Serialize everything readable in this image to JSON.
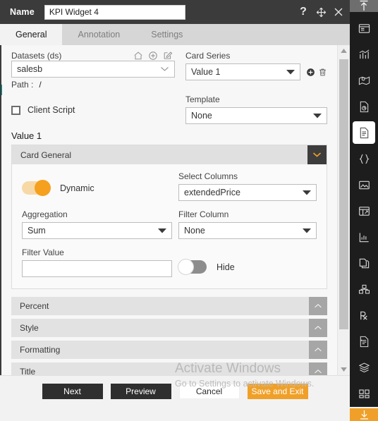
{
  "titlebar": {
    "name_label": "Name",
    "widget_name": "KPI Widget 4",
    "widget_name_placeholder": "Name",
    "help_icon": "?",
    "move_icon": "move-icon",
    "close_icon": "close-icon"
  },
  "tabs": [
    {
      "label": "General",
      "active": true
    },
    {
      "label": "Annotation",
      "active": false
    },
    {
      "label": "Settings",
      "active": false
    }
  ],
  "datasets": {
    "label": "Datasets (ds)",
    "value": "salesb",
    "icons": [
      "home-icon",
      "add-circle-icon",
      "edit-icon"
    ],
    "path_label": "Path :",
    "path_value": "/"
  },
  "client_script": {
    "label": "Client Script",
    "checked": false
  },
  "card_series": {
    "label": "Card Series",
    "value": "Value 1",
    "add_icon": "add-circle-filled-icon",
    "delete_icon": "trash-icon"
  },
  "template": {
    "label": "Template",
    "value": "None"
  },
  "value_section": {
    "title": "Value 1",
    "card_general": {
      "header": "Card General",
      "collapse_icon": "chevron-down-icon",
      "dynamic": {
        "label": "Dynamic",
        "state": "on"
      },
      "select_columns": {
        "label": "Select Columns",
        "value": "extendedPrice"
      },
      "aggregation": {
        "label": "Aggregation",
        "value": "Sum"
      },
      "filter_column": {
        "label": "Filter Column",
        "value": "None"
      },
      "filter_value": {
        "label": "Filter Value",
        "value": "",
        "placeholder": ""
      },
      "hide": {
        "label": "Hide",
        "state": "off"
      }
    }
  },
  "accordions": [
    {
      "label": "Percent",
      "icon": "chevron-up-icon"
    },
    {
      "label": "Style",
      "icon": "chevron-up-icon"
    },
    {
      "label": "Formatting",
      "icon": "chevron-up-icon"
    },
    {
      "label": "Title",
      "icon": "chevron-up-icon"
    }
  ],
  "watermark": {
    "line1": "Activate Windows",
    "line2": "Go to Settings to activate Windows."
  },
  "footer": {
    "next": "Next",
    "preview": "Preview",
    "cancel": "Cancel",
    "save_exit": "Save and Exit"
  },
  "rail": {
    "top_icon": "collapse-up-icon",
    "items": [
      {
        "icon": "window-layout-icon",
        "active": false
      },
      {
        "icon": "bar-chart-icon",
        "active": false
      },
      {
        "icon": "map-pin-icon",
        "active": false
      },
      {
        "icon": "document-chart-icon",
        "active": false
      },
      {
        "icon": "document-lines-icon",
        "active": true
      },
      {
        "icon": "code-braces-icon",
        "active": false
      },
      {
        "icon": "image-icon",
        "active": false
      },
      {
        "icon": "table-icon",
        "active": false
      },
      {
        "icon": "analytics-icon",
        "active": false
      },
      {
        "icon": "copy-page-icon",
        "active": false
      },
      {
        "icon": "cubes-icon",
        "active": false
      },
      {
        "icon": "prescription-rx-icon",
        "active": false
      },
      {
        "icon": "document-list-icon",
        "active": false
      },
      {
        "icon": "layers-icon",
        "active": false
      },
      {
        "icon": "grid-blocks-icon",
        "active": false
      }
    ],
    "bottom_icon": "download-icon"
  },
  "scrollbar": {
    "up_arrow": "caret-up-icon",
    "down_arrow": "caret-down-icon"
  },
  "colors": {
    "accent": "#f0a028",
    "titlebar": "#3b3b3b",
    "teal_marker": "#00a99a"
  }
}
